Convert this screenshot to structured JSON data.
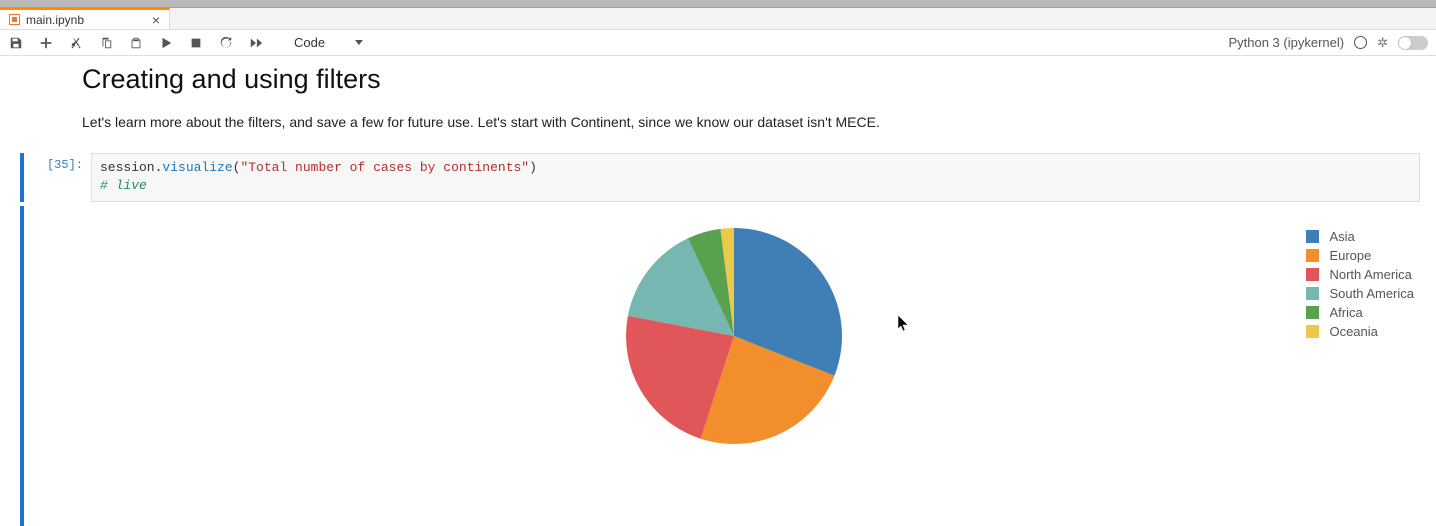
{
  "tab": {
    "label": "main.ipynb"
  },
  "toolbar": {
    "cell_type": "Code",
    "kernel_name": "Python 3 (ipykernel)"
  },
  "markdown": {
    "heading": "Creating and using filters",
    "paragraph": "Let's learn more about the filters, and save a few for future use. Let's start with Continent, since we know our dataset isn't MECE."
  },
  "code_cell": {
    "prompt": "[35]:",
    "line1_obj": "session.",
    "line1_method": "visualize",
    "line1_paren_open": "(",
    "line1_string": "\"Total number of cases by continents\"",
    "line1_paren_close": ")",
    "line2_comment": "# live"
  },
  "chart_data": {
    "type": "pie",
    "series": [
      {
        "name": "Asia",
        "value": 31,
        "color": "#3f7fb5"
      },
      {
        "name": "Europe",
        "value": 24,
        "color": "#f28e2c"
      },
      {
        "name": "North America",
        "value": 23,
        "color": "#e15759"
      },
      {
        "name": "South America",
        "value": 15,
        "color": "#76b7b2"
      },
      {
        "name": "Africa",
        "value": 5,
        "color": "#59a14f"
      },
      {
        "name": "Oceania",
        "value": 2,
        "color": "#edc949"
      }
    ]
  }
}
